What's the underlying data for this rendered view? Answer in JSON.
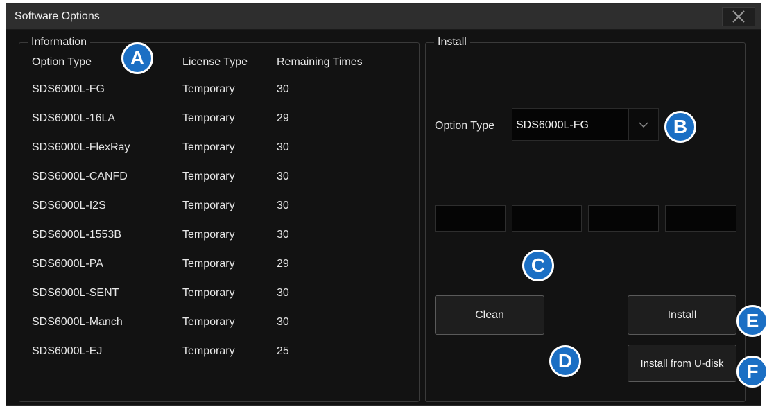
{
  "window": {
    "title": "Software Options",
    "close_icon": "close-icon"
  },
  "information": {
    "legend": "Information",
    "headers": [
      "Option Type",
      "License Type",
      "Remaining Times"
    ],
    "rows": [
      [
        "SDS6000L-FG",
        "Temporary",
        "30"
      ],
      [
        "SDS6000L-16LA",
        "Temporary",
        "29"
      ],
      [
        "SDS6000L-FlexRay",
        "Temporary",
        "30"
      ],
      [
        "SDS6000L-CANFD",
        "Temporary",
        "30"
      ],
      [
        "SDS6000L-I2S",
        "Temporary",
        "30"
      ],
      [
        "SDS6000L-1553B",
        "Temporary",
        "30"
      ],
      [
        "SDS6000L-PA",
        "Temporary",
        "29"
      ],
      [
        "SDS6000L-SENT",
        "Temporary",
        "30"
      ],
      [
        "SDS6000L-Manch",
        "Temporary",
        "30"
      ],
      [
        "SDS6000L-EJ",
        "Temporary",
        "25"
      ]
    ]
  },
  "install": {
    "legend": "Install",
    "option_type_label": "Option Type",
    "option_type_value": "SDS6000L-FG",
    "dropdown_icon": "chevron-down-icon",
    "license_key_fields": [
      "",
      "",
      "",
      ""
    ],
    "clean_label": "Clean",
    "install_label": "Install",
    "install_udisk_label": "Install from U-disk"
  },
  "callouts": [
    "A",
    "B",
    "C",
    "D",
    "E",
    "F"
  ],
  "colors": {
    "window_bg": "#121212",
    "titlebar_bg": "#2e2e2e",
    "callout_blue": "#1b6fc4"
  }
}
